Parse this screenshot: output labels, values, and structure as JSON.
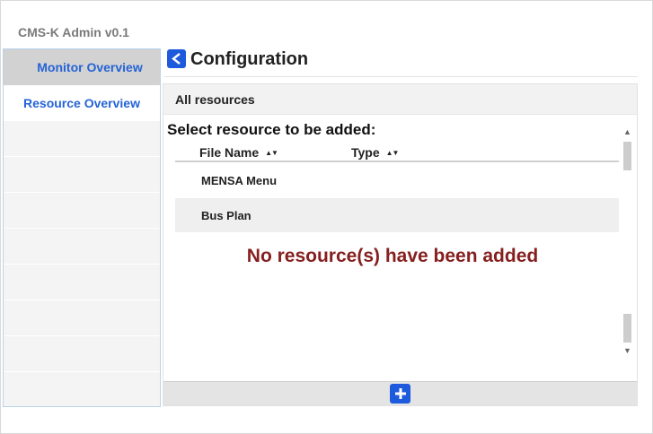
{
  "app": {
    "title": "CMS-K Admin v0.1"
  },
  "sidebar": {
    "items": [
      {
        "label": "Monitor Overview",
        "active": true
      },
      {
        "label": "Resource Overview",
        "active": false
      }
    ]
  },
  "header": {
    "title": "Configuration",
    "back_icon": "chevron-left-icon"
  },
  "panel": {
    "heading": "All resources",
    "select_label": "Select resource to be added:",
    "columns": [
      {
        "label": "File Name",
        "sort_icon": "sort-icon"
      },
      {
        "label": "Type",
        "sort_icon": "sort-icon"
      }
    ],
    "rows": [
      {
        "file_name": "MENSA Menu",
        "type": ""
      },
      {
        "file_name": "Bus Plan",
        "type": ""
      }
    ],
    "empty_message": "No resource(s) have been added",
    "add_icon": "plus-icon"
  },
  "colors": {
    "accent": "#1e5adc",
    "link": "#2563d6",
    "empty_message": "#861f1f"
  }
}
